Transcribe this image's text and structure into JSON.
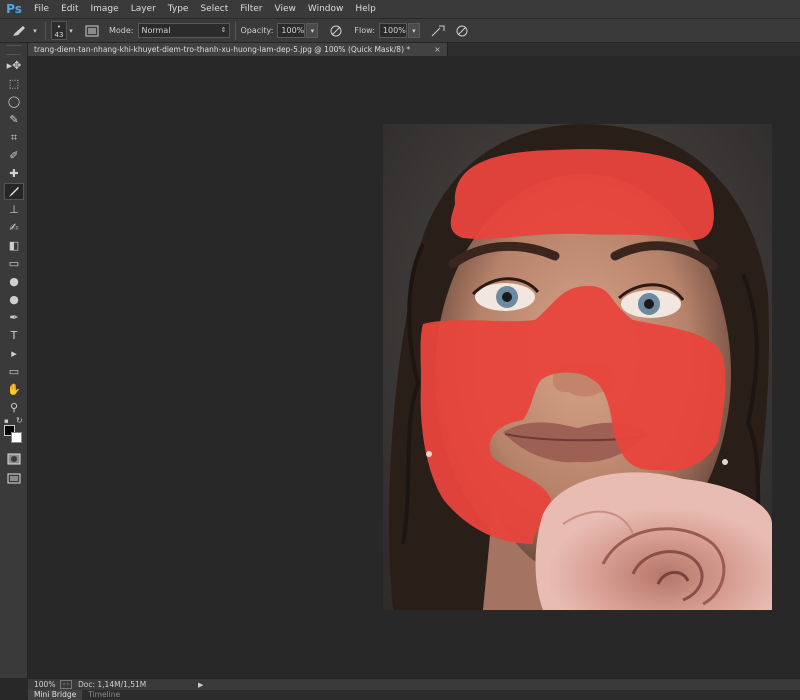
{
  "app": {
    "logo": "Ps"
  },
  "menu": [
    "File",
    "Edit",
    "Image",
    "Layer",
    "Type",
    "Select",
    "Filter",
    "View",
    "Window",
    "Help"
  ],
  "options": {
    "brush_size": "43",
    "mode_label": "Mode:",
    "mode_value": "Normal",
    "opacity_label": "Opacity:",
    "opacity_value": "100%",
    "flow_label": "Flow:",
    "flow_value": "100%"
  },
  "document": {
    "tab_title": "trang-diem-tan-nhang-khi-khuyet-diem-tro-thanh-xu-huong-lam-dep-5.jpg @ 100% (Quick Mask/8) *",
    "close_glyph": "×"
  },
  "tools": [
    "move-tool",
    "marquee-tool",
    "lasso-tool",
    "quick-selection-tool",
    "crop-tool",
    "eyedropper-tool",
    "spot-healing-tool",
    "brush-tool",
    "clone-stamp-tool",
    "history-brush-tool",
    "eraser-tool",
    "gradient-tool",
    "blur-tool",
    "dodge-tool",
    "pen-tool",
    "type-tool",
    "path-selection-tool",
    "rectangle-tool",
    "hand-tool",
    "zoom-tool"
  ],
  "tool_glyphs": [
    "▸✥",
    "⬚",
    "◯",
    "✎",
    "⌗",
    "✐",
    "✚",
    "🖌",
    "⊥",
    "✍",
    "◧",
    "▭",
    "●",
    "●",
    "✒",
    "T",
    "▸",
    "▭",
    "✋",
    "⚲"
  ],
  "colors": {
    "foreground": "#000000",
    "background": "#ffffff",
    "mask_overlay": "#e8453c"
  },
  "status": {
    "zoom": "100%",
    "doc_info": "Doc: 1,14M/1,51M"
  },
  "bottom_tabs": [
    "Mini Bridge",
    "Timeline"
  ]
}
